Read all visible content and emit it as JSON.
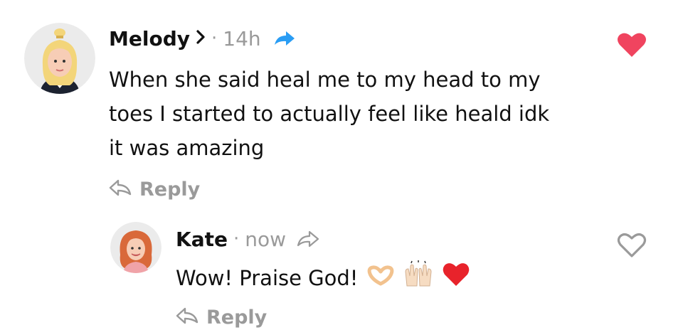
{
  "comments": [
    {
      "author": "Melody",
      "time": "14h",
      "text_lines": [
        "When she said heal me to my head to my",
        "toes I started to actually feel like heald idk",
        "it was amazing"
      ],
      "reply_label": "Reply",
      "liked": true,
      "icons": [
        "avatar",
        "chevron-right-icon",
        "share-arrow-icon",
        "heart-filled-icon",
        "reply-arrow-icon"
      ]
    },
    {
      "author": "Kate",
      "time": "now",
      "text": "Wow! Praise God!",
      "emojis": [
        "heart-hands-emoji",
        "raised-hands-emoji",
        "red-heart-emoji"
      ],
      "reply_label": "Reply",
      "liked": false,
      "icons": [
        "avatar",
        "share-arrow-icon",
        "heart-outline-icon",
        "reply-arrow-icon"
      ]
    }
  ],
  "colors": {
    "like_red": "#f0445f",
    "share_blue": "#2a9df4",
    "meta_gray": "#9a9a9a",
    "text": "#111111"
  }
}
